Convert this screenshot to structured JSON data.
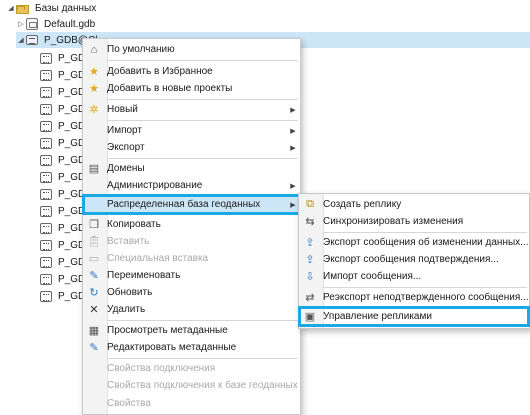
{
  "tree": {
    "root_label": "Базы данных",
    "default_gdb": "Default.gdb",
    "connection": "P_GDB@Cl...",
    "items": [
      "P_GDB",
      "P_GDB",
      "P_GDB",
      "P_GDB",
      "P_GDB",
      "P_GDB",
      "P_GDB",
      "P_GDB",
      "P_GDB",
      "P_GDB",
      "P_GDB",
      "P_GDB",
      "P_GDB",
      "P_GDB",
      "P_GDB"
    ]
  },
  "context_menu": {
    "default": "По умолчанию",
    "add_favorites": "Добавить в Избранное",
    "add_new_projects": "Добавить в новые проекты",
    "new": "Новый",
    "import": "Импорт",
    "export": "Экспорт",
    "domains": "Домены",
    "administration": "Администрирование",
    "distributed_gdb": "Распределенная база геоданных",
    "copy": "Копировать",
    "paste": "Вставить",
    "paste_special": "Специальная вставка",
    "rename": "Переименовать",
    "refresh": "Обновить",
    "delete": "Удалить",
    "view_metadata": "Просмотреть метаданные",
    "edit_metadata": "Редактировать метаданные",
    "conn_props": "Свойства подключения",
    "conn_props_gdb": "Свойства подключения к базе геоданных",
    "props": "Свойства"
  },
  "submenu": {
    "create_replica": "Создать реплику",
    "sync_changes": "Синхронизировать изменения",
    "export_change_msg": "Экспорт сообщения об изменении данных...",
    "export_ack_msg": "Экспорт сообщения подтверждения...",
    "import_msg": "Импорт сообщения...",
    "reexport_unack": "Реэкспорт неподтвержденного сообщения...",
    "manage_replicas": "Управление репликами"
  },
  "colors": {
    "highlight_border": "#1aa9e6",
    "selection_bg": "#cde6f7"
  }
}
